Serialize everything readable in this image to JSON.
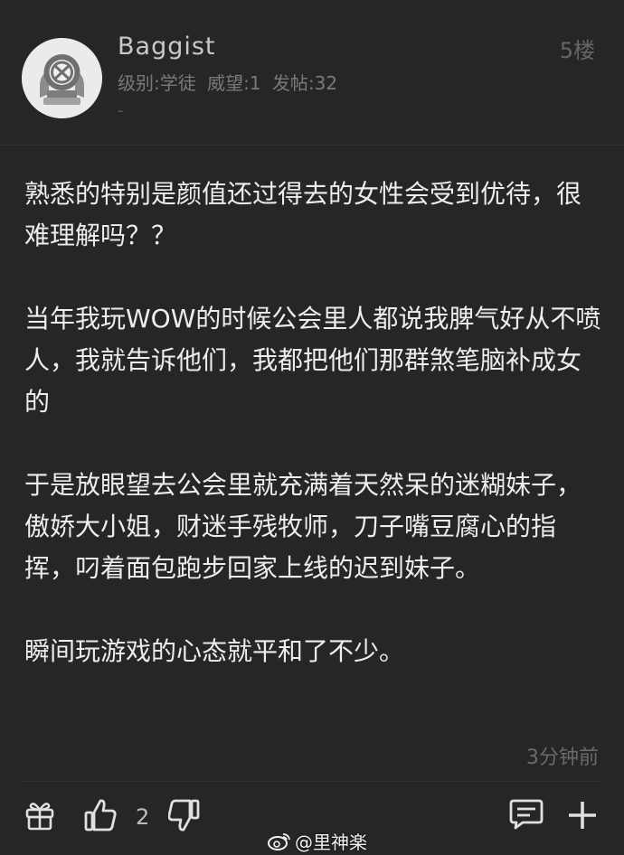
{
  "header": {
    "username": "Baggist",
    "level_label": "级别:学徒",
    "prestige_label": "威望:1",
    "posts_label": "发帖:32",
    "signature": "-",
    "floor": "5楼"
  },
  "post": {
    "paragraphs": [
      "熟悉的特别是颜值还过得去的女性会受到优待，很难理解吗？？",
      "当年我玩WOW的时候公会里人都说我脾气好从不喷人，我就告诉他们，我都把他们那群煞笔脑补成女的",
      "于是放眼望去公会里就充满着天然呆的迷糊妹子，傲娇大小姐，财迷手残牧师，刀子嘴豆腐心的指挥，叼着面包跑步回家上线的迟到妹子。",
      "瞬间玩游戏的心态就平和了不少。"
    ],
    "timestamp": "3分钟前"
  },
  "toolbar": {
    "like_count": "2",
    "icons": [
      "gift-icon",
      "thumbs-up-icon",
      "thumbs-down-icon",
      "comment-icon",
      "plus-icon"
    ]
  },
  "watermark": {
    "text": "@里神楽",
    "icon": "weibo-logo"
  },
  "colors": {
    "background": "#262628",
    "text": "#ededed",
    "muted": "#7a7a7a"
  }
}
